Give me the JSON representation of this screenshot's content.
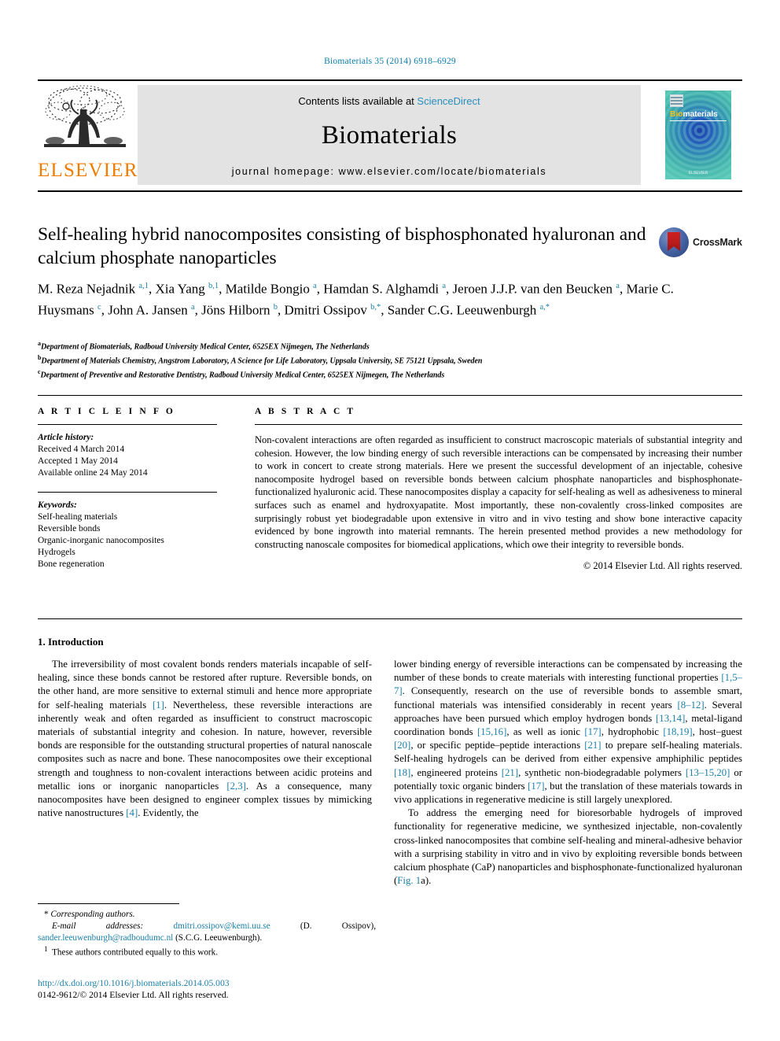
{
  "running_head": "Biomaterials 35 (2014) 6918–6929",
  "masthead": {
    "contents_prefix": "Contents lists available at ",
    "sciencedirect": "ScienceDirect",
    "journal_name": "Biomaterials",
    "homepage": "journal homepage: www.elsevier.com/locate/biomaterials",
    "publisher_wordmark": "ELSEVIER",
    "cover": {
      "title_part1": "Bio",
      "title_part2": "materials",
      "footer": "ELSEVIER"
    },
    "colors": {
      "elsevier_orange": "#f07c00",
      "link_blue": "#2a8fbd",
      "band_gray": "#e3e3e3"
    }
  },
  "crossmark": {
    "label": "CrossMark",
    "circle_color": "#26407c",
    "mark_color": "#c02020"
  },
  "article": {
    "title": "Self-healing hybrid nanocomposites consisting of bisphosphonated hyaluronan and calcium phosphate nanoparticles",
    "authors_html": "M. Reza Nejadnik <sup>a,1</sup>, Xia Yang <sup>b,1</sup>, Matilde Bongio <sup>a</sup>, Hamdan S. Alghamdi <sup>a</sup>, Jeroen J.J.P. van den Beucken <sup>a</sup>, Marie C. Huysmans <sup>c</sup>, John A. Jansen <sup>a</sup>, Jöns Hilborn <sup>b</sup>, Dmitri Ossipov <sup>b,*</sup>, Sander C.G. Leeuwenburgh <sup>a,*</sup>",
    "affiliations": [
      {
        "marker": "a",
        "text": "Department of Biomaterials, Radboud University Medical Center, 6525EX Nijmegen, The Netherlands"
      },
      {
        "marker": "b",
        "text": "Department of Materials Chemistry, Angstrom Laboratory, A Science for Life Laboratory, Uppsala University, SE 75121 Uppsala, Sweden"
      },
      {
        "marker": "c",
        "text": "Department of Preventive and Restorative Dentistry, Radboud University Medical Center, 6525EX Nijmegen, The Netherlands"
      }
    ]
  },
  "article_info": {
    "heading": "A R T I C L E  I N F O",
    "history_label": "Article history:",
    "history": [
      "Received 4 March 2014",
      "Accepted 1 May 2014",
      "Available online 24 May 2014"
    ],
    "keywords_label": "Keywords:",
    "keywords": [
      "Self-healing materials",
      "Reversible bonds",
      "Organic-inorganic nanocomposites",
      "Hydrogels",
      "Bone regeneration"
    ]
  },
  "abstract": {
    "heading": "A B S T R A C T",
    "text": "Non-covalent interactions are often regarded as insufficient to construct macroscopic materials of substantial integrity and cohesion. However, the low binding energy of such reversible interactions can be compensated by increasing their number to work in concert to create strong materials. Here we present the successful development of an injectable, cohesive nanocomposite hydrogel based on reversible bonds between calcium phosphate nanoparticles and bisphosphonate-functionalized hyaluronic acid. These nanocomposites display a capacity for self-healing as well as adhesiveness to mineral surfaces such as enamel and hydroxyapatite. Most importantly, these non-covalently cross-linked composites are surprisingly robust yet biodegradable upon extensive in vitro and in vivo testing and show bone interactive capacity evidenced by bone ingrowth into material remnants. The herein presented method provides a new methodology for constructing nanoscale composites for biomedical applications, which owe their integrity to reversible bonds.",
    "copyright": "© 2014 Elsevier Ltd. All rights reserved."
  },
  "body": {
    "section_heading": "1. Introduction",
    "left_paragraph_1_html": "The irreversibility of most covalent bonds renders materials incapable of self-healing, since these bonds cannot be restored after rupture. Reversible bonds, on the other hand, are more sensitive to external stimuli and hence more appropriate for self-healing materials <span class=\"ref\">[1]</span>. Nevertheless, these reversible interactions are inherently weak and often regarded as insufficient to construct macroscopic materials of substantial integrity and cohesion. In nature, however, reversible bonds are responsible for the outstanding structural properties of natural nanoscale composites such as nacre and bone. These nanocomposites owe their exceptional strength and toughness to non-covalent interactions between acidic proteins and metallic ions or inorganic nanoparticles <span class=\"ref\">[2,3]</span>. As a consequence, many nanocomposites have been designed to engineer complex tissues by mimicking native nanostructures <span class=\"ref\">[4]</span>. Evidently, the",
    "right_paragraph_1_html": "lower binding energy of reversible interactions can be compensated by increasing the number of these bonds to create materials with interesting functional properties <span class=\"ref\">[1,5–7]</span>. Consequently, research on the use of reversible bonds to assemble smart, functional materials was intensified considerably in recent years <span class=\"ref\">[8–12]</span>. Several approaches have been pursued which employ hydrogen bonds <span class=\"ref\">[13,14]</span>, metal-ligand coordination bonds <span class=\"ref\">[15,16]</span>, as well as ionic <span class=\"ref\">[17]</span>, hydrophobic <span class=\"ref\">[18,19]</span>, host–guest <span class=\"ref\">[20]</span>, or specific peptide–peptide interactions <span class=\"ref\">[21]</span> to prepare self-healing materials. Self-healing hydrogels can be derived from either expensive amphiphilic peptides <span class=\"ref\">[18]</span>, engineered proteins <span class=\"ref\">[21]</span>, synthetic non-biodegradable polymers <span class=\"ref\">[13–15,20]</span> or potentially toxic organic binders <span class=\"ref\">[17]</span>, but the translation of these materials towards in vivo applications in regenerative medicine is still largely unexplored.",
    "right_paragraph_2_html": "To address the emerging need for bioresorbable hydrogels of improved functionality for regenerative medicine, we synthesized injectable, non-covalently cross-linked nanocomposites that combine self-healing and mineral-adhesive behavior with a surprising stability in vitro and in vivo by exploiting reversible bonds between calcium phosphate (CaP) nanoparticles and bisphosphonate-functionalized hyaluronan (<span class=\"ref\">Fig. 1</span>a)."
  },
  "footnotes": {
    "corresponding_html": "* <span style=\"font-style:italic\">Corresponding authors.</span>",
    "email_html": "<em>E-mail addresses:</em> <span class=\"link\">dmitri.ossipov@kemi.uu.se</span> (D. Ossipov), <span class=\"link\">sander.leeuwenburgh@radboudumc.nl</span> (S.C.G. Leeuwenburgh).",
    "equal_contrib_html": "<sup>1</sup>&nbsp; These authors contributed equally to this work."
  },
  "doi_block": {
    "doi": "http://dx.doi.org/10.1016/j.biomaterials.2014.05.003",
    "issn_line": "0142-9612/© 2014 Elsevier Ltd. All rights reserved."
  }
}
